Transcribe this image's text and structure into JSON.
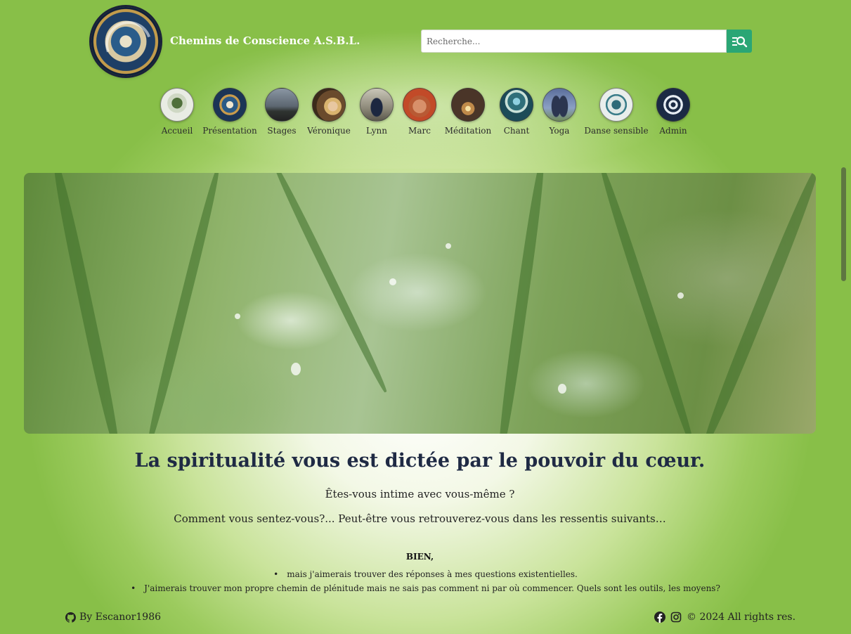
{
  "header": {
    "site_title": "Chemins de Conscience A.S.B.L.",
    "logo_icon": "spiral-mandala-logo"
  },
  "search": {
    "placeholder": "Recherche...",
    "button_icon": "search-list-icon",
    "button_color": "#2aa675"
  },
  "nav": {
    "items": [
      {
        "label": "Accueil",
        "icon": "clover-icon"
      },
      {
        "label": "Présentation",
        "icon": "yin-yang-icon"
      },
      {
        "label": "Stages",
        "icon": "landscape-icon"
      },
      {
        "label": "Véronique",
        "icon": "portrait-icon"
      },
      {
        "label": "Lynn",
        "icon": "meditating-figure-icon"
      },
      {
        "label": "Marc",
        "icon": "portrait-icon"
      },
      {
        "label": "Méditation",
        "icon": "candle-icon"
      },
      {
        "label": "Chant",
        "icon": "mandala-icon"
      },
      {
        "label": "Yoga",
        "icon": "yoga-icon"
      },
      {
        "label": "Danse sensible",
        "icon": "wave-emblem-icon"
      },
      {
        "label": "Admin",
        "icon": "target-icon"
      }
    ]
  },
  "main": {
    "hero_image": "dewy-clover-leaves-photo",
    "headline": "La spiritualité vous est dictée par le pouvoir du cœur.",
    "question": "Êtes-vous intime avec vous-même ?",
    "intro": "Comment vous sentez-vous?... Peut-être vous retrouverez-vous dans les ressentis suivants…",
    "section_label": "BIEN,",
    "bullets": [
      "mais j'aimerais trouver des réponses à mes questions existentielles.",
      "J'aimerais trouver mon propre chemin de plénitude mais ne sais pas comment ni par où commencer. Quels sont les outils, les moyens?"
    ]
  },
  "footer": {
    "author": "By Escanor1986",
    "copyright": "© 2024 All rights res.",
    "left_icon": "github-icon",
    "social_icons": [
      "facebook-icon",
      "instagram-icon"
    ]
  },
  "colors": {
    "background": "#88bf48",
    "headline": "#1f2a44",
    "title": "#ffffff"
  }
}
